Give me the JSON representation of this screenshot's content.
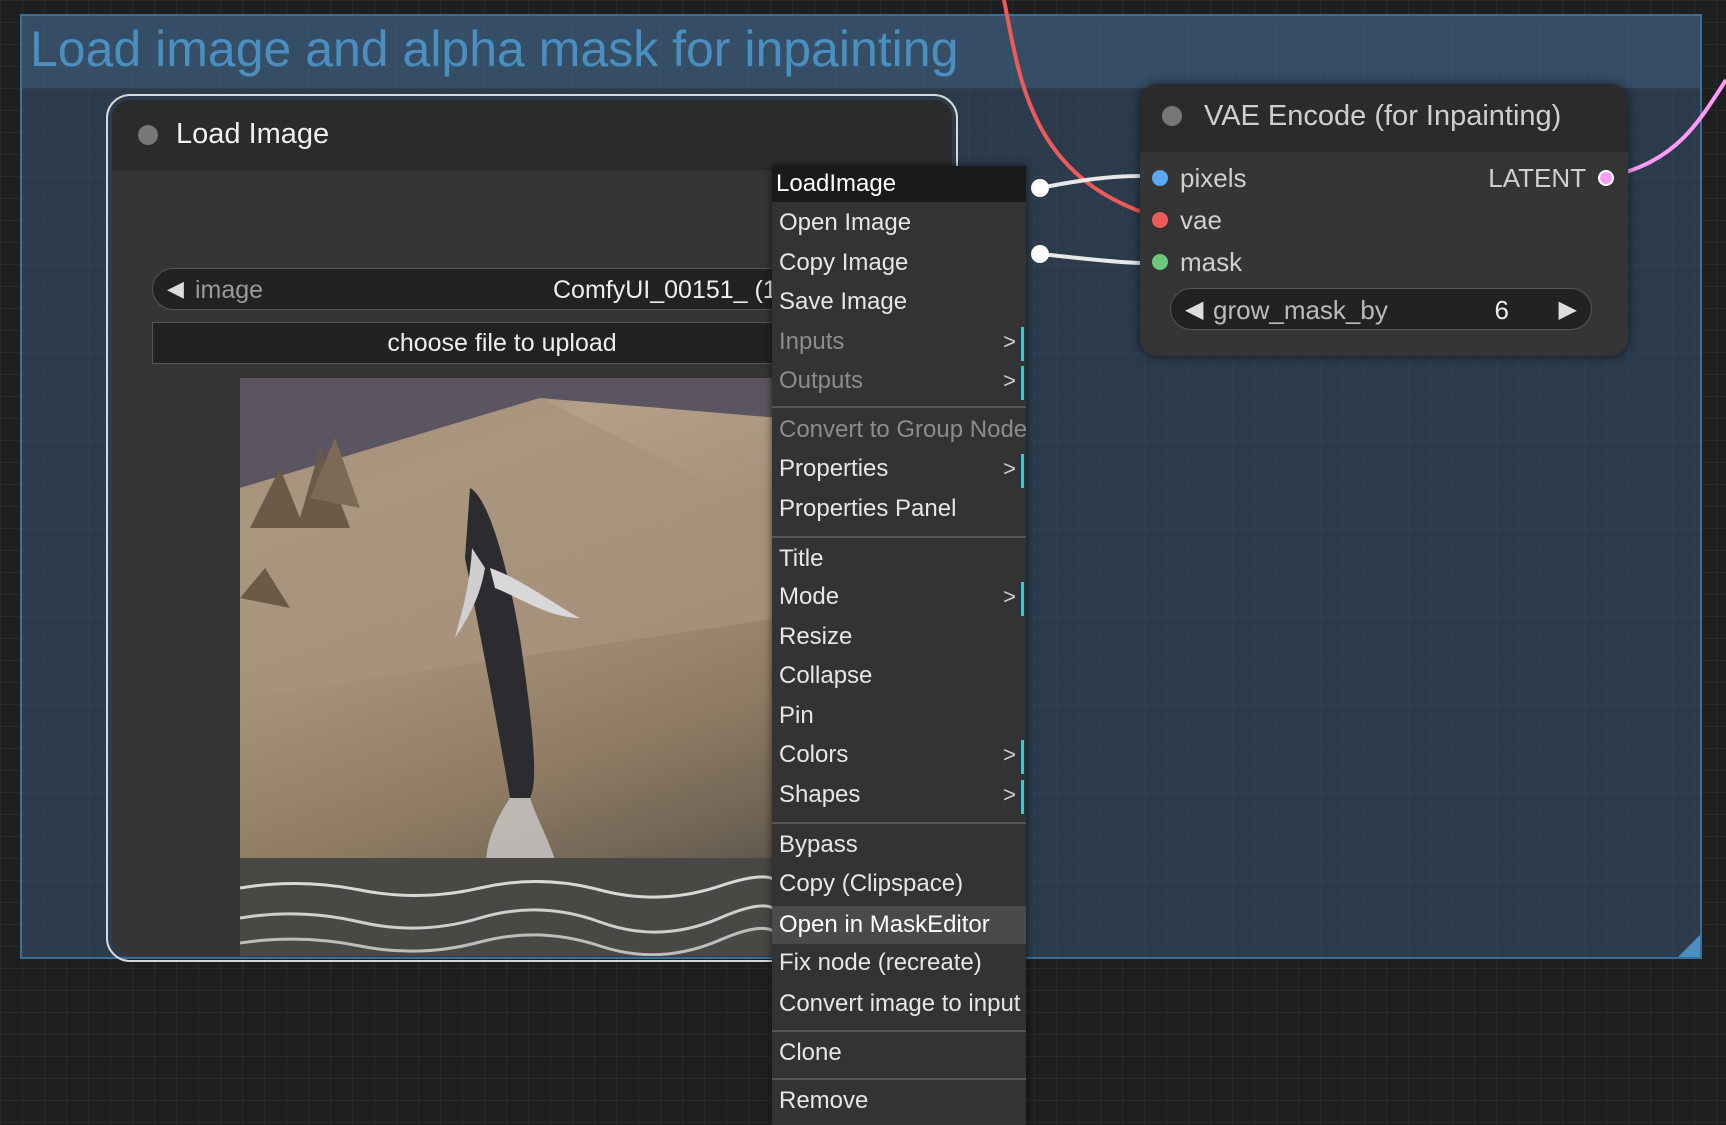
{
  "group": {
    "title": "Load image and alpha mask for inpainting"
  },
  "load_image_node": {
    "title": "Load Image",
    "image_widget": {
      "name": "image",
      "value": "ComfyUI_00151_ (1"
    },
    "upload_button": "choose file to upload"
  },
  "vae_node": {
    "title": "VAE Encode (for Inpainting)",
    "inputs": [
      "pixels",
      "vae",
      "mask"
    ],
    "output": "LATENT",
    "grow_mask_by": {
      "name": "grow_mask_by",
      "value": "6"
    }
  },
  "context_menu": {
    "title": "LoadImage",
    "items": [
      {
        "label": "Open Image"
      },
      {
        "label": "Copy Image"
      },
      {
        "label": "Save Image"
      },
      {
        "label": "Inputs",
        "disabled": true,
        "submenu": true
      },
      {
        "label": "Outputs",
        "disabled": true,
        "submenu": true
      },
      {
        "label": "Convert to Group Node",
        "disabled": true
      },
      {
        "label": "Properties",
        "submenu": true
      },
      {
        "label": "Properties Panel"
      },
      {
        "label": "Title"
      },
      {
        "label": "Mode",
        "submenu": true
      },
      {
        "label": "Resize"
      },
      {
        "label": "Collapse"
      },
      {
        "label": "Pin"
      },
      {
        "label": "Colors",
        "submenu": true
      },
      {
        "label": "Shapes",
        "submenu": true
      },
      {
        "label": "Bypass"
      },
      {
        "label": "Copy (Clipspace)"
      },
      {
        "label": "Open in MaskEditor",
        "highlighted": true
      },
      {
        "label": "Fix node (recreate)"
      },
      {
        "label": "Convert image to input"
      },
      {
        "label": "Clone"
      },
      {
        "label": "Remove"
      }
    ],
    "submenu_glyph": ">"
  },
  "colors": {
    "pixels_slot": "#5aa8f0",
    "vae_slot": "#ee5a5a",
    "mask_slot": "#6cc87a",
    "latent_slot": "#ff9cf9",
    "group_border": "#3a6f98"
  }
}
